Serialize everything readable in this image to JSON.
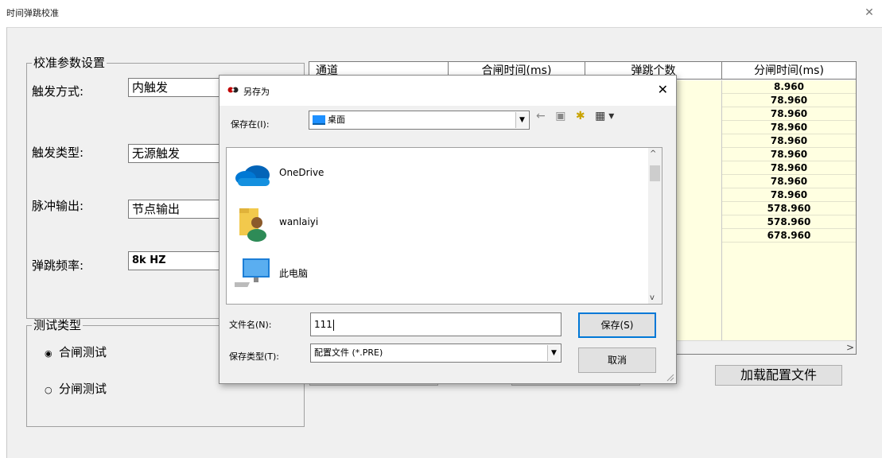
{
  "main": {
    "title": "时间弹跳校准",
    "close_glyph": "✕",
    "calib_group": {
      "legend": "校准参数设置",
      "fields": [
        {
          "label": "触发方式:",
          "value": "内触发"
        },
        {
          "label": "触发类型:",
          "value": "无源触发"
        },
        {
          "label": "脉冲输出:",
          "value": "节点输出"
        },
        {
          "label": "弹跳频率:",
          "value": "8k HZ"
        }
      ]
    },
    "test_group": {
      "legend": "测试类型",
      "options": [
        {
          "label": "合闸测试",
          "selected": true,
          "glyph": "◉"
        },
        {
          "label": "分闸测试",
          "selected": false,
          "glyph": "○"
        }
      ]
    },
    "table": {
      "columns": [
        "通道",
        "合闸时间(ms)",
        "弹跳个数",
        "分闸时间(ms)"
      ],
      "open_time_values": [
        "8.960",
        "78.960",
        "78.960",
        "78.960",
        "78.960",
        "78.960",
        "78.960",
        "78.960",
        "78.960",
        "578.960",
        "578.960",
        "678.960"
      ],
      "scroll_right_glyph": ">"
    },
    "load_config_button": "加载配置文件"
  },
  "dialog": {
    "title": "另存为",
    "close_glyph": "✕",
    "save_in_label": "保存在(I):",
    "save_in_value": "桌面",
    "toolbar": [
      "back-arrow-icon",
      "up-folder-icon",
      "new-folder-icon",
      "view-menu-icon"
    ],
    "toolbar_glyphs": {
      "back": "←",
      "up": "▣",
      "new": "✱",
      "view": "▦▾"
    },
    "items": [
      {
        "name": "OneDrive",
        "icon": "onedrive-cloud-icon"
      },
      {
        "name": "wanlaiyi",
        "icon": "user-folder-icon"
      },
      {
        "name": "此电脑",
        "icon": "computer-icon"
      }
    ],
    "filename_label": "文件名(N):",
    "filename_value": "111",
    "filetype_label": "保存类型(T):",
    "filetype_value": "配置文件 (*.PRE)",
    "save_button": "保存(S)",
    "cancel_button": "取消",
    "dropdown_glyph": "▼",
    "scroll_up_glyph": "^",
    "scroll_down_glyph": "v"
  }
}
